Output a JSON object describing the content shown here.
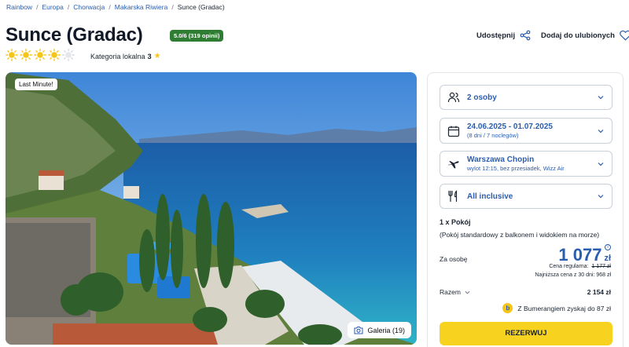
{
  "breadcrumb": {
    "items": [
      "Rainbow",
      "Europa",
      "Chorwacja",
      "Makarska Riwiera"
    ],
    "separator": "/",
    "current": "Sunce (Gradac)"
  },
  "hotel": {
    "name": "Sunce (Gradac)",
    "rating_badge": "5.0/6 (319 opinii)",
    "suns_total": 5,
    "suns_filled": 4.5,
    "category_label": "Kategoria lokalna",
    "category_value": "3",
    "category_star": "★"
  },
  "actions": {
    "share_label": "Udostępnij",
    "fav_label": "Dodaj do ulubionych"
  },
  "photo": {
    "badge": "Last Minute!",
    "gallery_label": "Galeria (19)"
  },
  "booking": {
    "persons": "2 osoby",
    "dates": "24.06.2025 - 01.07.2025",
    "dates_sub": "(8 dni / 7 noclegów)",
    "airport": "Warszawa Chopin",
    "flight_info": "wylot 12:15, bez przesiadek, Wizz Air",
    "board": "All inclusive",
    "room_count": "1 x Pokój",
    "room_desc": "(Pokój standardowy z balkonem i widokiem na morze)",
    "per_person_label": "Za osobę",
    "price": "1 077",
    "currency": "zł",
    "regular_label": "Cena regularna:",
    "regular_price": "1 177 zł",
    "lowest_text": "Najniższa cena z 30 dni: 968 zł",
    "total_label": "Razem",
    "total_value": "2 154 zł",
    "bumerang_text": "Z Bumerangiem zyskaj do 87 zł",
    "bumerang_icon_text": "b",
    "reserve_label": "REZERWUJ"
  },
  "colors": {
    "link_blue": "#2a5db0",
    "rating_green": "#2e7d32",
    "sun_yellow": "#f5c518",
    "button_yellow": "#f7d21f"
  }
}
